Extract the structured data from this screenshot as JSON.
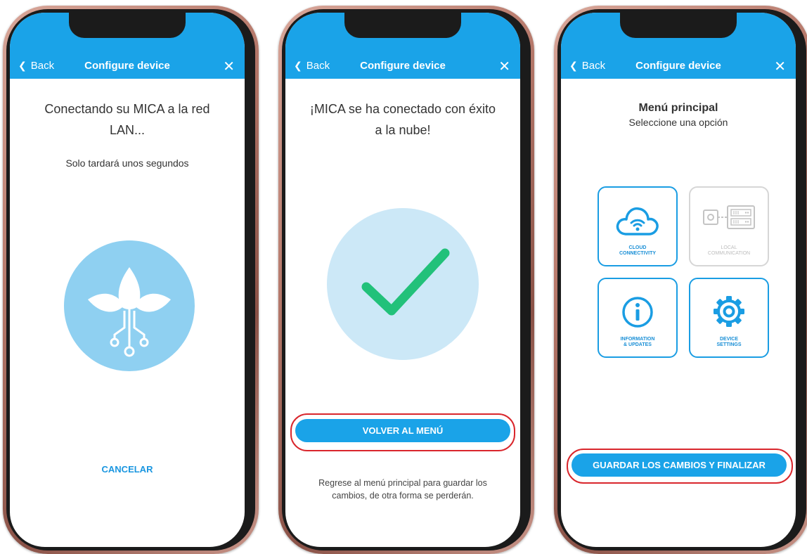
{
  "nav": {
    "back_label": "Back",
    "title": "Configure device",
    "close_symbol": "✕"
  },
  "screen1": {
    "heading": "Conectando su MICA a la red LAN...",
    "subtext": "Solo tardará unos segundos",
    "illustration": "plant-circuit-icon",
    "cancel_label": "CANCELAR"
  },
  "screen2": {
    "heading": "¡MICA se ha conectado con éxito a la nube!",
    "illustration": "checkmark-icon",
    "button_label": "VOLVER AL MENÚ",
    "note": "Regrese al menú principal para guardar los cambios, de otra forma se perderán."
  },
  "screen3": {
    "title": "Menú principal",
    "subtitle": "Seleccione una opción",
    "tiles": [
      {
        "label": "CLOUD\nCONNECTIVITY",
        "icon": "cloud-wifi-icon",
        "enabled": true
      },
      {
        "label": "LOCAL\nCOMMUNICATION",
        "icon": "local-network-icon",
        "enabled": false
      },
      {
        "label": "INFORMATION\n& UPDATES",
        "icon": "info-icon",
        "enabled": true
      },
      {
        "label": "DEVICE\nSETTINGS",
        "icon": "gear-icon",
        "enabled": true
      }
    ],
    "button_label": "GUARDAR LOS CAMBIOS Y FINALIZAR"
  },
  "colors": {
    "accent": "#1aa3e8",
    "highlight": "#d9262c",
    "success": "#22c17a",
    "circle_light": "#cce8f7",
    "circle_plant": "#8fd0f1"
  }
}
